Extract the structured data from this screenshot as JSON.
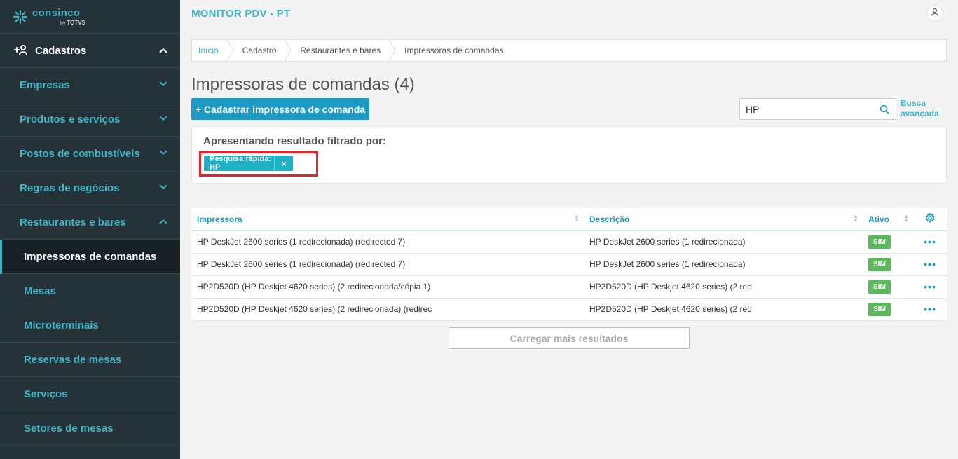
{
  "logo": {
    "name": "consinco",
    "by": "by",
    "brand": "TOTVS"
  },
  "sidebar": {
    "section": {
      "label": "Cadastros",
      "icon": "add-user-icon"
    },
    "items": [
      {
        "label": "Empresas"
      },
      {
        "label": "Produtos e serviços"
      },
      {
        "label": "Postos de combustíveis"
      },
      {
        "label": "Regras de negócios"
      },
      {
        "label": "Restaurantes e bares"
      }
    ],
    "subitems": [
      {
        "label": "Impressoras de comandas",
        "active": true
      },
      {
        "label": "Mesas"
      },
      {
        "label": "Microterminais"
      },
      {
        "label": "Reservas de mesas"
      },
      {
        "label": "Serviços"
      },
      {
        "label": "Setores de mesas"
      }
    ]
  },
  "header": {
    "title": "MONITOR PDV - PT",
    "user_icon": "user-icon"
  },
  "breadcrumb": [
    "Início",
    "Cadastro",
    "Restaurantes e bares",
    "Impressoras de comandas"
  ],
  "page": {
    "title": "Impressoras de comandas (4)",
    "add_button": "+ Cadastrar impressora de comanda"
  },
  "search": {
    "value": "HP",
    "advanced_line1": "Busca",
    "advanced_line2": "avançada"
  },
  "filter": {
    "label": "Apresentando resultado filtrado por:",
    "tag": "Pesquisa rápida: HP",
    "close": "×"
  },
  "table": {
    "columns": [
      "Impressora",
      "Descrição",
      "Ativo"
    ],
    "rows": [
      {
        "printer": "HP DeskJet 2600 series (1 redirecionada) (redirected 7)",
        "description": "HP DeskJet 2600 series (1 redirecionada)",
        "active": "SIM"
      },
      {
        "printer": "HP DeskJet 2600 series (1 redirecionada) (redirected 7)",
        "description": "HP DeskJet 2600 series (1 redirecionada)",
        "active": "SIM"
      },
      {
        "printer": "HP2D520D (HP Deskjet 4620 series) (2 redirecionada/cópia 1)",
        "description": "HP2D520D (HP Deskjet 4620 series) (2 red",
        "active": "SIM"
      },
      {
        "printer": "HP2D520D (HP Deskjet 4620 series) (2 redirecionada) (redirec",
        "description": "HP2D520D (HP Deskjet 4620 series) (2 red",
        "active": "SIM"
      }
    ],
    "row_menu": "•••"
  },
  "load_more": "Carregar mais resultados",
  "colors": {
    "sidebar_bg": "#253238",
    "accent": "#3fb5c7",
    "primary_button": "#1e9bc4",
    "success": "#5cb85c",
    "highlight": "#e3242b"
  }
}
